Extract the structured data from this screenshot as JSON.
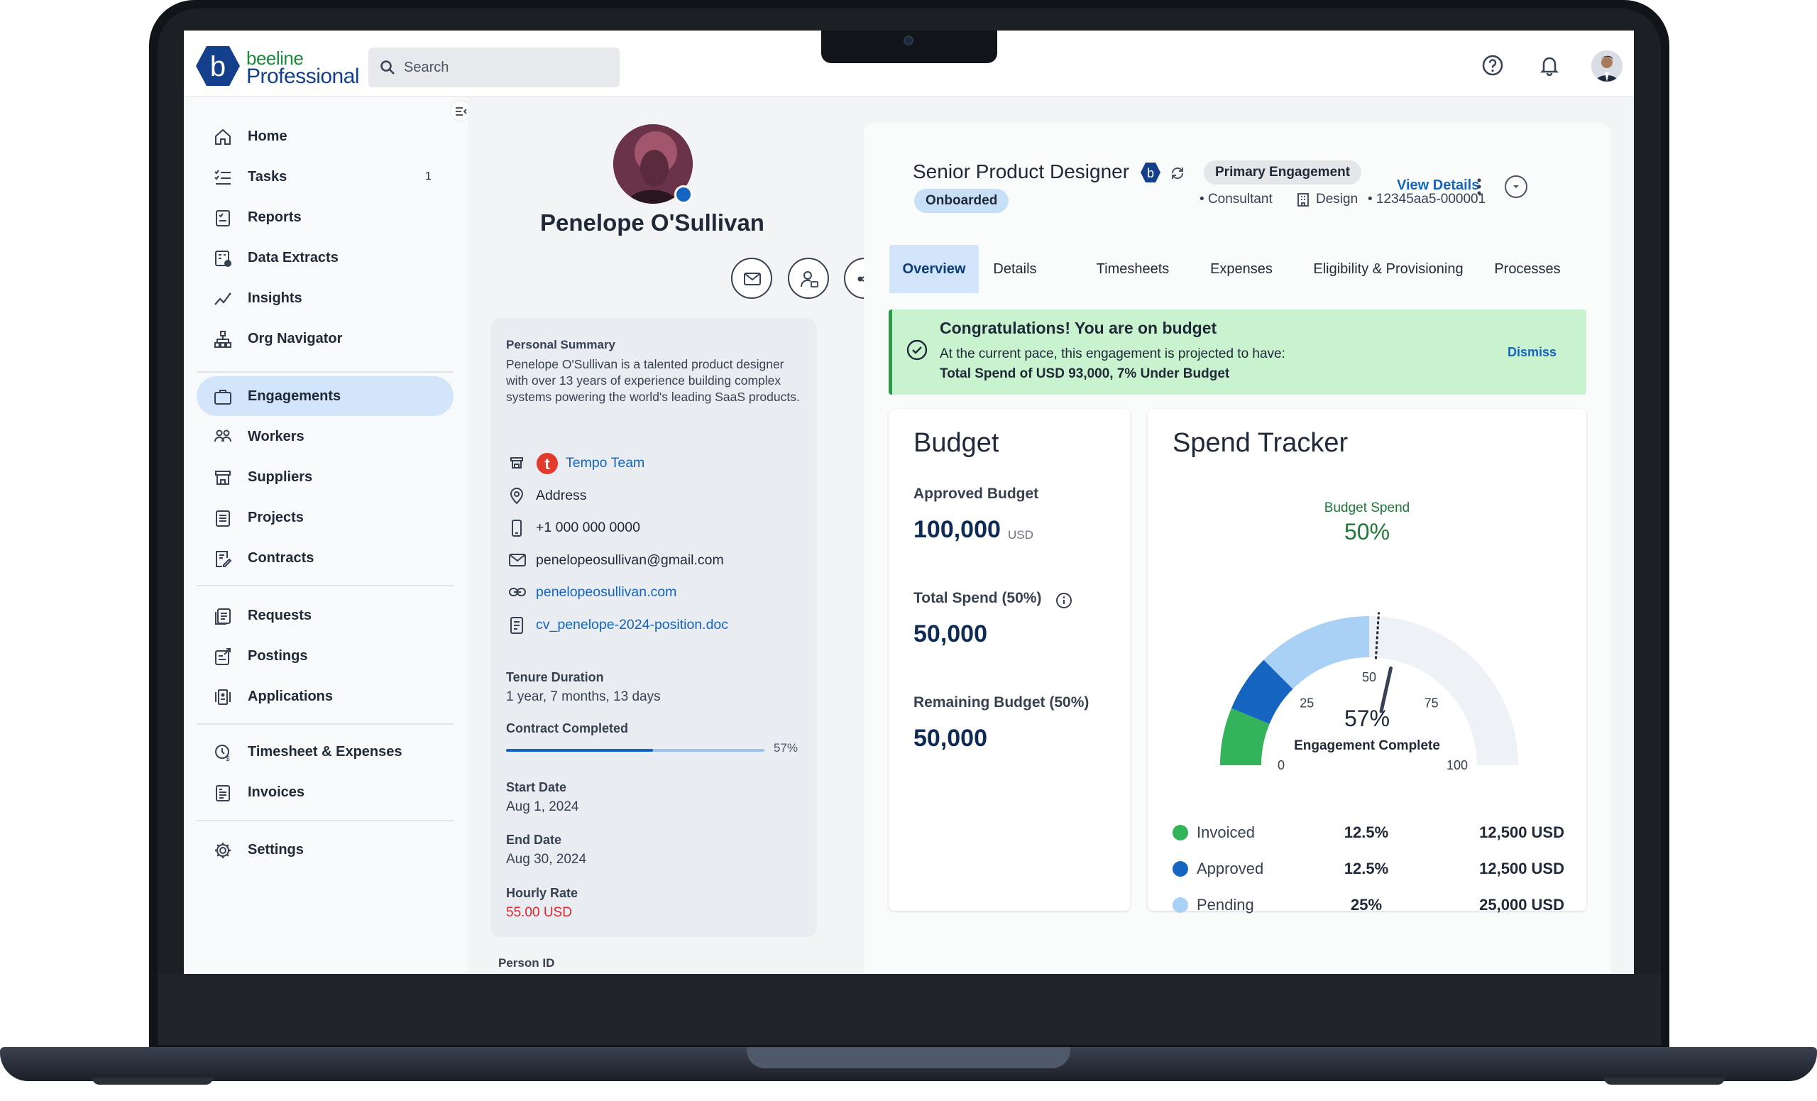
{
  "app": {
    "logo_top": "beeline",
    "logo_bottom": "Professional",
    "logo_letter": "b",
    "search_placeholder": "Search"
  },
  "sidebar": {
    "items": [
      {
        "label": "Home",
        "icon": "home-icon"
      },
      {
        "label": "Tasks",
        "icon": "tasks-icon",
        "count": "1"
      },
      {
        "label": "Reports",
        "icon": "reports-icon"
      },
      {
        "label": "Data Extracts",
        "icon": "data-extracts-icon"
      },
      {
        "label": "Insights",
        "icon": "insights-icon"
      },
      {
        "label": "Org Navigator",
        "icon": "org-navigator-icon"
      },
      {
        "label": "Engagements",
        "icon": "briefcase-icon",
        "active": true
      },
      {
        "label": "Workers",
        "icon": "workers-icon"
      },
      {
        "label": "Suppliers",
        "icon": "suppliers-icon"
      },
      {
        "label": "Projects",
        "icon": "projects-icon"
      },
      {
        "label": "Contracts",
        "icon": "contracts-icon"
      },
      {
        "label": "Requests",
        "icon": "requests-icon"
      },
      {
        "label": "Postings",
        "icon": "postings-icon"
      },
      {
        "label": "Applications",
        "icon": "applications-icon"
      },
      {
        "label": "Timesheet & Expenses",
        "icon": "timesheet-icon"
      },
      {
        "label": "Invoices",
        "icon": "invoices-icon"
      },
      {
        "label": "Settings",
        "icon": "gear-icon"
      }
    ]
  },
  "profile": {
    "name": "Penelope O'Sullivan",
    "summary_label": "Personal Summary",
    "summary": "Penelope O'Sullivan is a talented product designer with over 13 years of experience building complex systems powering the world's leading SaaS products.",
    "team_letter": "t",
    "team": "Tempo Team",
    "address": "Address",
    "phone": "+1 000 000 0000",
    "email": "penelopeosullivan@gmail.com",
    "website": "penelopeosullivan.com",
    "cv": "cv_penelope-2024-position.doc",
    "tenure_label": "Tenure Duration",
    "tenure": "1 year, 7 months, 13 days",
    "contract_label": "Contract Completed",
    "contract_progress": 0.57,
    "contract_pct": "57%",
    "start_label": "Start Date",
    "start": "Aug 1, 2024",
    "end_label": "End Date",
    "end": "Aug 30, 2024",
    "rate_label": "Hourly Rate",
    "rate": "55.00 USD",
    "person_id_label": "Person ID"
  },
  "engagement": {
    "title": "Senior Product Designer",
    "primary_chip": "Primary Engagement",
    "status_chip": "Onboarded",
    "type": "• Consultant",
    "department": "Design",
    "id": "• 12345aa5-000001",
    "view_details": "View Details",
    "tabs": [
      "Overview",
      "Details",
      "Timesheets",
      "Expenses",
      "Eligibility & Provisioning",
      "Processes"
    ],
    "active_tab": 0
  },
  "alert": {
    "title": "Congratulations! You are on budget",
    "line1": "At the current pace, this engagement is projected to have:",
    "line2": "Total Spend of USD 93,000, 7% Under Budget",
    "dismiss": "Dismiss"
  },
  "budget": {
    "heading": "Budget",
    "approved_label": "Approved Budget",
    "approved_value": "100,000",
    "approved_unit": "USD",
    "spend_label": "Total Spend (50%)",
    "spend_value": "50,000",
    "remaining_label": "Remaining Budget (50%)",
    "remaining_value": "50,000"
  },
  "tracker": {
    "heading": "Spend Tracker",
    "budget_spend_label": "Budget Spend",
    "budget_spend_pct": "50%",
    "complete_pct": "57%",
    "complete_label": "Engagement Complete",
    "legend": [
      {
        "name": "Invoiced",
        "pct": "12.5%",
        "amount": "12,500 USD",
        "color": "#34b45a"
      },
      {
        "name": "Approved",
        "pct": "12.5%",
        "amount": "12,500 USD",
        "color": "#1565c0"
      },
      {
        "name": "Pending",
        "pct": "25%",
        "amount": "25,000 USD",
        "color": "#a9d0f5"
      }
    ]
  },
  "chart_data": {
    "type": "gauge",
    "ticks": [
      "0",
      "25",
      "50",
      "75",
      "100"
    ],
    "segments": [
      {
        "name": "Invoiced",
        "from": 0,
        "to": 12.5,
        "color": "#34b45a"
      },
      {
        "name": "Approved",
        "from": 12.5,
        "to": 25,
        "color": "#1565c0"
      },
      {
        "name": "Pending",
        "from": 25,
        "to": 50,
        "color": "#a9d0f5"
      }
    ],
    "budget_marker": 52,
    "needle": 57,
    "range": [
      0,
      100
    ]
  }
}
